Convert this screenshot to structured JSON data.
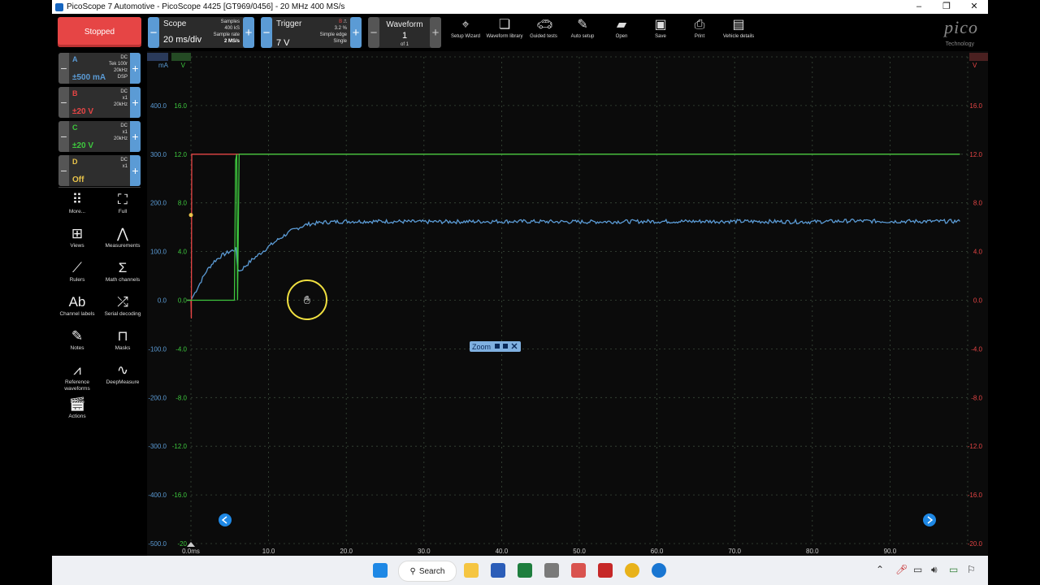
{
  "window": {
    "title": "PicoScope 7 Automotive  - PicoScope 4425 [GT969/0456] - 20 MHz 400 MS/s",
    "min": "–",
    "max": "❐",
    "close": "✕"
  },
  "toolbar": {
    "run_state": "Stopped",
    "scope": {
      "label": "Scope",
      "value": "20 ms/div",
      "samples_label": "Samples",
      "samples": "400 kS",
      "rate_label": "Sample rate",
      "rate": "2 MS/s"
    },
    "trigger": {
      "label": "Trigger",
      "value": "7 V",
      "channel": "B",
      "percent": "3.2 %",
      "type": "Simple edge",
      "mode": "Single"
    },
    "waveform": {
      "label": "Waveform",
      "value": "1",
      "of": "of 1"
    },
    "tools": [
      {
        "label": "Setup Wizard",
        "icon": "setup-wizard-icon"
      },
      {
        "label": "Waveform library",
        "icon": "waveform-library-icon"
      },
      {
        "label": "Guided tests",
        "icon": "car-icon"
      },
      {
        "label": "Auto setup",
        "icon": "auto-setup-icon"
      },
      {
        "label": "Open",
        "icon": "folder-icon"
      },
      {
        "label": "Save",
        "icon": "save-icon"
      },
      {
        "label": "Print",
        "icon": "print-icon"
      },
      {
        "label": "Vehicle details",
        "icon": "clipboard-icon"
      }
    ],
    "logo": "pico",
    "logo_sub": "Technology"
  },
  "channels": [
    {
      "letter": "A",
      "range": "±500 mA",
      "info1": "DC",
      "info2": "Tek 100r",
      "info3": "20kHz",
      "info4": "DSP",
      "color": "#5b9bd5"
    },
    {
      "letter": "B",
      "range": "±20 V",
      "info1": "DC",
      "info2": "x1",
      "info3": "20kHz",
      "info4": "",
      "color": "#e64545"
    },
    {
      "letter": "C",
      "range": "±20 V",
      "info1": "DC",
      "info2": "x1",
      "info3": "20kHz",
      "info4": "",
      "color": "#3ec83e"
    },
    {
      "letter": "D",
      "range": "Off",
      "info1": "DC",
      "info2": "x1",
      "info3": "",
      "info4": "",
      "color": "#e8c34a"
    }
  ],
  "side_tools": [
    {
      "label": "More...",
      "icon": "grid-dots-icon"
    },
    {
      "label": "Full",
      "icon": "fullscreen-icon"
    },
    {
      "label": "Views",
      "icon": "views-icon"
    },
    {
      "label": "Measurements",
      "icon": "measurements-icon"
    },
    {
      "label": "Rulers",
      "icon": "ruler-icon"
    },
    {
      "label": "Math channels",
      "icon": "sigma-icon"
    },
    {
      "label": "Channel labels",
      "icon": "channel-labels-icon"
    },
    {
      "label": "Serial decoding",
      "icon": "serial-decoding-icon"
    },
    {
      "label": "Notes",
      "icon": "notes-icon"
    },
    {
      "label": "Masks",
      "icon": "masks-icon"
    },
    {
      "label": "Reference waveforms",
      "icon": "reference-waveform-icon"
    },
    {
      "label": "DeepMeasure",
      "icon": "deepmeasure-icon"
    },
    {
      "label": "Actions",
      "icon": "clapper-icon"
    }
  ],
  "chart_data": {
    "type": "line",
    "x_unit": "ms",
    "xlim": [
      0,
      100
    ],
    "x_ticks": [
      "0.0",
      "10.0",
      "20.0",
      "30.0",
      "40.0",
      "50.0",
      "60.0",
      "70.0",
      "80.0",
      "90.0"
    ],
    "x_first_tick_label": "0.0ms",
    "axis_a": {
      "unit": "mA",
      "top": "500.0",
      "ylim": [
        -500,
        500
      ],
      "ticks": [
        "400.0",
        "300.0",
        "200.0",
        "100.0",
        "0.0",
        "-100.0",
        "-200.0",
        "-300.0",
        "-400.0",
        "-500.0"
      ]
    },
    "axis_c": {
      "unit": "V",
      "top": "20.0",
      "ylim": [
        -20,
        20
      ],
      "ticks": [
        "16.0",
        "12.0",
        "8.0",
        "4.0",
        "0.0",
        "-4.0",
        "-8.0",
        "-12.0",
        "-16.0",
        "-20"
      ]
    },
    "axis_b": {
      "unit": "V",
      "top": "20.0",
      "ylim": [
        -20,
        20
      ],
      "ticks": [
        "16.0",
        "12.0",
        "8.0",
        "4.0",
        "0.0",
        "-4.0",
        "-8.0",
        "-12.0",
        "-16.0",
        "-20.0"
      ]
    },
    "series": [
      {
        "name": "A",
        "unit": "mA",
        "color": "#5b9bd5",
        "x": [
          -0.5,
          0,
          1,
          2,
          3,
          4,
          5,
          5.8,
          6.0,
          6.3,
          7,
          8,
          9,
          10,
          11,
          12,
          13,
          14,
          15,
          17,
          20,
          25,
          30,
          40,
          50,
          60,
          70,
          80,
          85,
          90,
          99
        ],
        "y": [
          0,
          0,
          30,
          60,
          80,
          92,
          100,
          105,
          65,
          60,
          70,
          85,
          97,
          110,
          122,
          133,
          143,
          150,
          156,
          160,
          162,
          162,
          161,
          162,
          161,
          162,
          162,
          161,
          163,
          162,
          162
        ]
      },
      {
        "name": "B",
        "unit": "V",
        "color": "#e64545",
        "x": [
          -0.5,
          0,
          0.05,
          0.1,
          0.3,
          99
        ],
        "y": [
          0,
          0,
          -1.5,
          12,
          12,
          12
        ]
      },
      {
        "name": "C",
        "unit": "V",
        "color": "#3ec83e",
        "x": [
          -0.5,
          5.6,
          5.75,
          5.9,
          6.0,
          6.2,
          99
        ],
        "y": [
          0,
          0,
          11.5,
          12,
          0,
          12,
          12
        ]
      }
    ],
    "trigger_marker": {
      "x": 0,
      "y_v": 7
    }
  },
  "zoom_overlay": {
    "label": "Zoom"
  },
  "taskbar": {
    "search": "Search"
  }
}
